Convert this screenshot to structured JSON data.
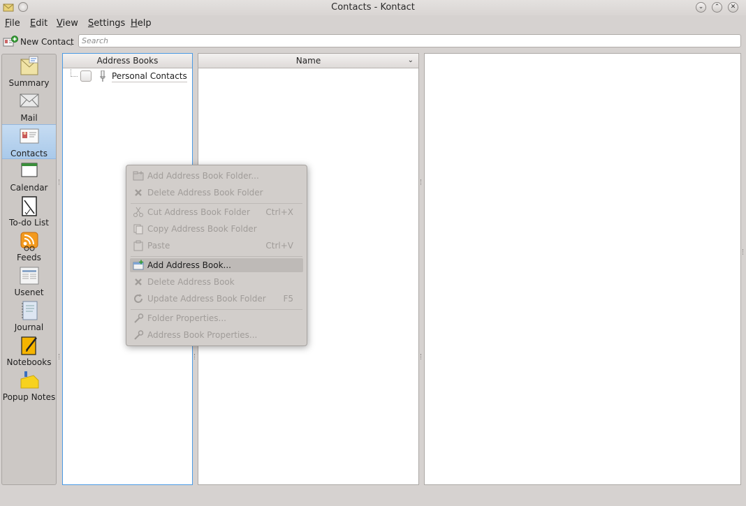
{
  "window": {
    "title": "Contacts - Kontact",
    "icons": [
      "kontact-app-icon",
      "pin-icon",
      "minimize-icon",
      "maximize-icon",
      "close-icon"
    ]
  },
  "menubar": {
    "items": [
      {
        "label": "File",
        "mnemonic": "F"
      },
      {
        "label": "Edit",
        "mnemonic": "E"
      },
      {
        "label": "View",
        "mnemonic": "V"
      },
      {
        "label": "Settings",
        "mnemonic": "S"
      },
      {
        "label": "Help",
        "mnemonic": "H"
      }
    ]
  },
  "toolbar": {
    "new_contact_label": "New Contact",
    "new_contact_icon": "contact-new-icon",
    "search_placeholder": "Search"
  },
  "sidebar": {
    "items": [
      {
        "label": "Summary",
        "icon": "summary-icon",
        "selected": false
      },
      {
        "label": "Mail",
        "icon": "mail-icon",
        "selected": false
      },
      {
        "label": "Contacts",
        "icon": "contacts-icon",
        "selected": true
      },
      {
        "label": "Calendar",
        "icon": "calendar-icon",
        "selected": false
      },
      {
        "label": "To-do List",
        "icon": "todo-icon",
        "selected": false
      },
      {
        "label": "Feeds",
        "icon": "feeds-icon",
        "selected": false
      },
      {
        "label": "Usenet",
        "icon": "usenet-icon",
        "selected": false
      },
      {
        "label": "Journal",
        "icon": "journal-icon",
        "selected": false
      },
      {
        "label": "Notebooks",
        "icon": "notebooks-icon",
        "selected": false
      },
      {
        "label": "Popup Notes",
        "icon": "popup-notes-icon",
        "selected": false
      }
    ]
  },
  "address_books": {
    "header": "Address Books",
    "items": [
      {
        "label": "Personal Contacts",
        "checked": false
      }
    ]
  },
  "contact_list": {
    "header": "Name"
  },
  "context_menu": {
    "items": [
      {
        "label": "Add Address Book Folder...",
        "shortcut": "",
        "enabled": false,
        "icon": "folder-new-icon"
      },
      {
        "label": "Delete Address Book Folder",
        "shortcut": "",
        "enabled": false,
        "icon": "delete-icon"
      },
      {
        "separator": true
      },
      {
        "label": "Cut Address Book Folder",
        "shortcut": "Ctrl+X",
        "enabled": false,
        "icon": "cut-icon"
      },
      {
        "label": "Copy Address Book Folder",
        "shortcut": "",
        "enabled": false,
        "icon": "copy-icon"
      },
      {
        "label": "Paste",
        "shortcut": "Ctrl+V",
        "enabled": false,
        "icon": "paste-icon"
      },
      {
        "separator": true
      },
      {
        "label": "Add Address Book...",
        "shortcut": "",
        "enabled": true,
        "highlighted": true,
        "icon": "address-book-new-icon"
      },
      {
        "label": "Delete Address Book",
        "shortcut": "",
        "enabled": false,
        "icon": "delete-icon"
      },
      {
        "label": "Update Address Book Folder",
        "shortcut": "F5",
        "enabled": false,
        "icon": "refresh-icon"
      },
      {
        "separator": true
      },
      {
        "label": "Folder Properties...",
        "shortcut": "",
        "enabled": false,
        "icon": "properties-icon"
      },
      {
        "label": "Address Book Properties...",
        "shortcut": "",
        "enabled": false,
        "icon": "properties-icon"
      }
    ]
  },
  "colors": {
    "selection_blue": "#a9c9ea",
    "focus_border": "#4b9ae4",
    "disabled_text": "#a09c99",
    "window_bg": "#d6d2d0"
  }
}
